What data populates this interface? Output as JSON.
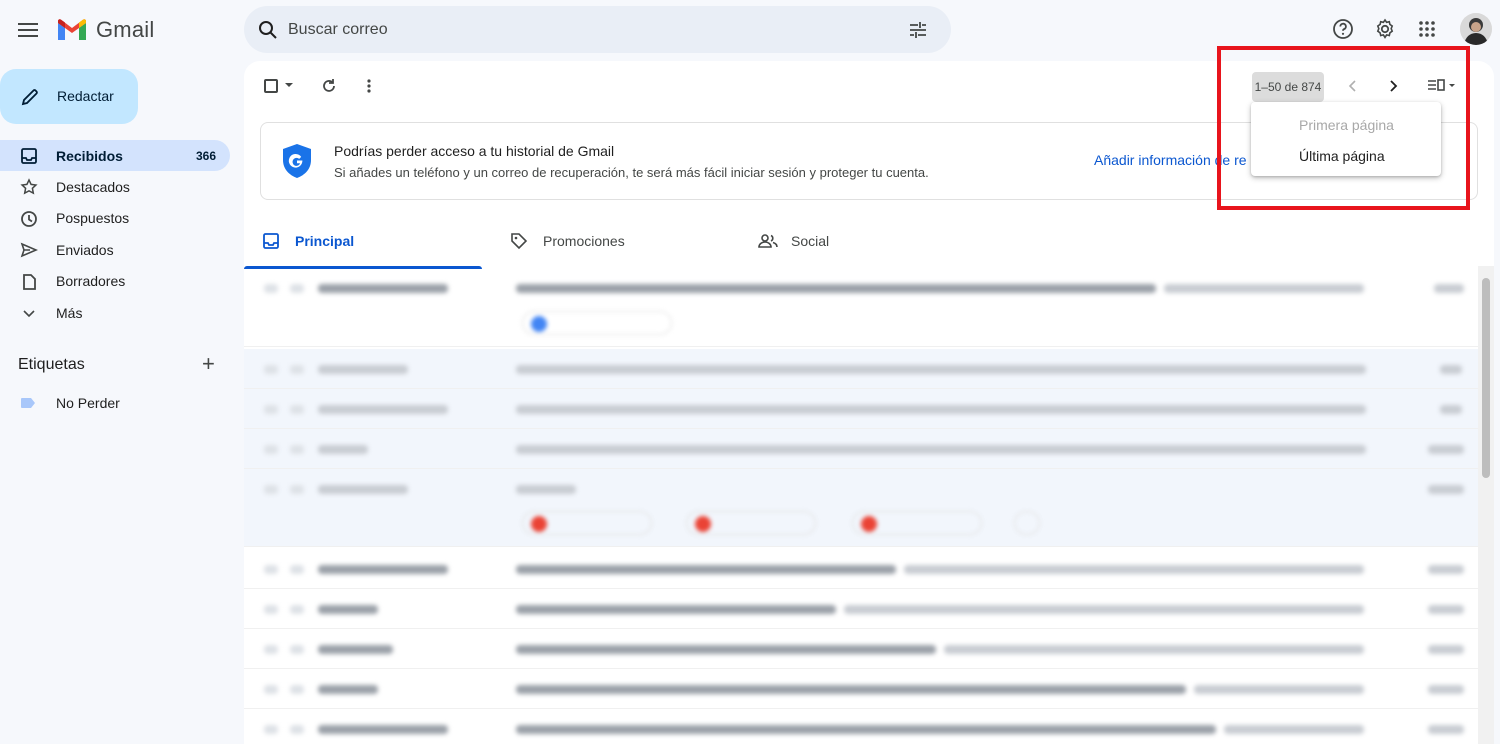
{
  "header": {
    "app_name": "Gmail",
    "search_placeholder": "Buscar correo"
  },
  "sidebar": {
    "compose_label": "Redactar",
    "items": [
      {
        "label": "Recibidos",
        "count": "366",
        "icon": "inbox-icon",
        "active": true
      },
      {
        "label": "Destacados",
        "count": "",
        "icon": "star-icon"
      },
      {
        "label": "Pospuestos",
        "count": "",
        "icon": "clock-icon"
      },
      {
        "label": "Enviados",
        "count": "",
        "icon": "send-icon"
      },
      {
        "label": "Borradores",
        "count": "",
        "icon": "draft-icon"
      },
      {
        "label": "Más",
        "count": "",
        "icon": "chevron-down-icon"
      }
    ],
    "labels_title": "Etiquetas",
    "labels_add": "+",
    "labels": [
      {
        "name": "No Perder",
        "color": "#a8c7fa"
      }
    ]
  },
  "toolbar": {
    "pagination": "1–50 de 874"
  },
  "banner": {
    "title": "Podrías perder acceso a tu historial de Gmail",
    "subtitle": "Si añades un teléfono y un correo de recuperación, te será más fácil iniciar sesión y proteger tu cuenta.",
    "link": "Añadir información de re"
  },
  "tabs": [
    {
      "label": "Principal",
      "icon": "inbox-icon",
      "active": true
    },
    {
      "label": "Promociones",
      "icon": "tag-icon"
    },
    {
      "label": "Social",
      "icon": "people-icon"
    }
  ],
  "pager_menu": {
    "first": "Primera página",
    "last": "Última página"
  },
  "colors": {
    "accent": "#0b57d0",
    "compose_bg": "#c2e7ff",
    "active_nav": "#d3e3fd",
    "highlight_box": "#e8141c"
  }
}
